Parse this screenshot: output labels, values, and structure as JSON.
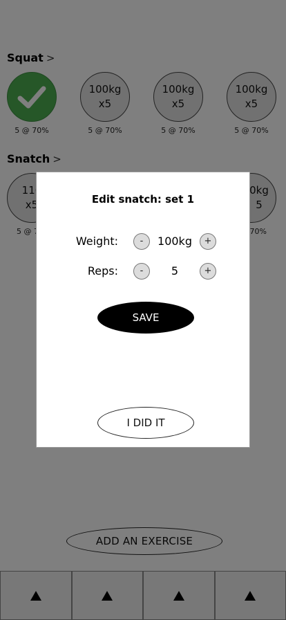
{
  "exercises": [
    {
      "name": "Squat",
      "chevron": ">",
      "sets": [
        {
          "state": "done",
          "weight": "",
          "reps": "",
          "caption": "5 @ 70%"
        },
        {
          "state": "pending",
          "weight": "100kg",
          "reps": "x5",
          "caption": "5 @ 70%"
        },
        {
          "state": "pending",
          "weight": "100kg",
          "reps": "x5",
          "caption": "5 @ 70%"
        },
        {
          "state": "pending",
          "weight": "100kg",
          "reps": "x5",
          "caption": "5 @ 70%"
        }
      ]
    },
    {
      "name": "Snatch",
      "chevron": ">",
      "sets": [
        {
          "state": "pending",
          "weight": "110",
          "reps": "x5",
          "caption": "5 @ 7"
        },
        {
          "state": "pending",
          "weight": "",
          "reps": "",
          "caption": ""
        },
        {
          "state": "pending",
          "weight": "",
          "reps": "",
          "caption": ""
        },
        {
          "state": "pending",
          "weight": "0kg",
          "reps": "5",
          "caption": "70%"
        }
      ]
    }
  ],
  "add_exercise_label": "ADD AN EXERCISE",
  "modal": {
    "title": "Edit snatch: set 1",
    "weight_label": "Weight:",
    "weight_value": "100kg",
    "reps_label": "Reps:",
    "reps_value": "5",
    "minus_symbol": "-",
    "plus_symbol": "+",
    "save_label": "SAVE",
    "did_it_label": "I DID IT"
  },
  "tabs": [
    "tab-1",
    "tab-2",
    "tab-3",
    "tab-4"
  ],
  "colors": {
    "done": "#4caf50",
    "overlay": "rgba(0,0,0,0.5)"
  }
}
